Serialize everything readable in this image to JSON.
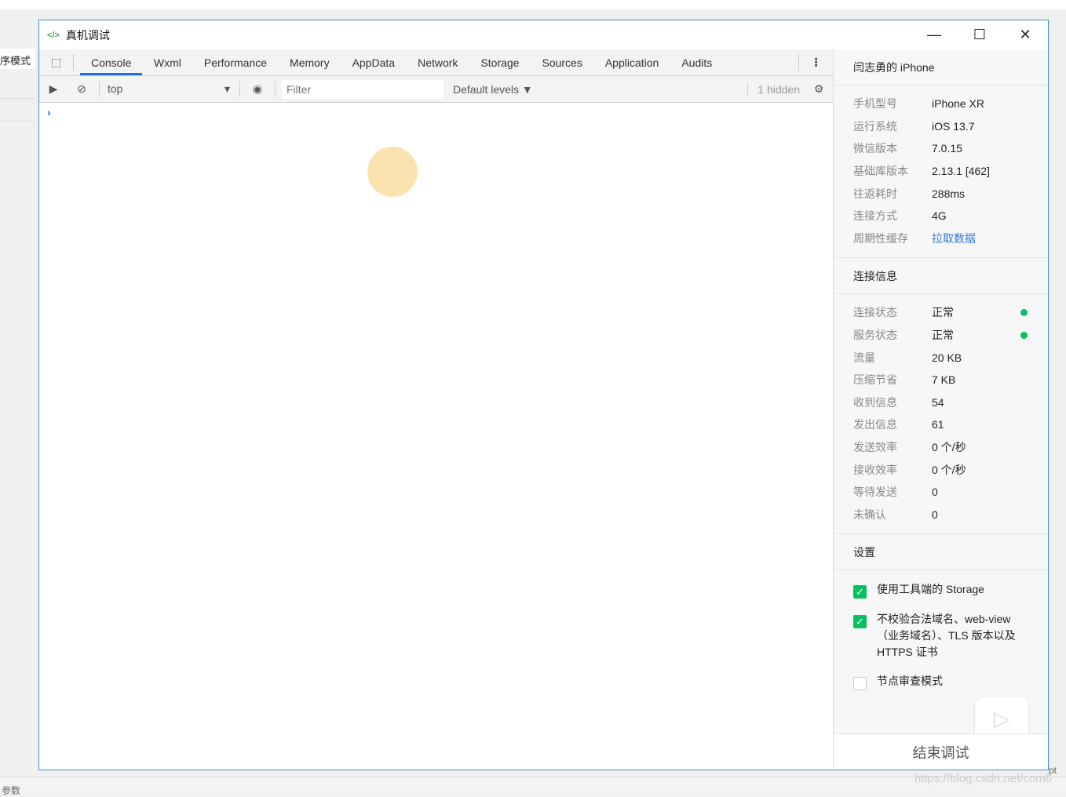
{
  "background": {
    "left_label": "序模式",
    "bottom_left": "参数",
    "bottom_right": "pt",
    "watermark": "https://blog.csdn.net/com6"
  },
  "window": {
    "title": "真机调试",
    "minimize": "—",
    "maximize": "☐",
    "close": "✕"
  },
  "tabs": [
    "Console",
    "Wxml",
    "Performance",
    "Memory",
    "AppData",
    "Network",
    "Storage",
    "Sources",
    "Application",
    "Audits"
  ],
  "toolbar": {
    "context": "top",
    "filter_placeholder": "Filter",
    "levels": "Default levels ▼",
    "hidden": "1 hidden"
  },
  "console": {
    "prompt": "›"
  },
  "device": {
    "title": "闫志勇的 iPhone",
    "rows": [
      {
        "k": "手机型号",
        "v": "iPhone XR"
      },
      {
        "k": "运行系统",
        "v": "iOS 13.7"
      },
      {
        "k": "微信版本",
        "v": "7.0.15"
      },
      {
        "k": "基础库版本",
        "v": "2.13.1 [462]"
      },
      {
        "k": "往返耗时",
        "v": "288ms"
      },
      {
        "k": "连接方式",
        "v": "4G"
      },
      {
        "k": "周期性缓存",
        "v": "拉取数据"
      }
    ]
  },
  "connection": {
    "title": "连接信息",
    "rows": [
      {
        "k": "连接状态",
        "v": "正常"
      },
      {
        "k": "服务状态",
        "v": "正常"
      },
      {
        "k": "流量",
        "v": "20 KB"
      },
      {
        "k": "压缩节省",
        "v": "7 KB"
      },
      {
        "k": "收到信息",
        "v": "54"
      },
      {
        "k": "发出信息",
        "v": "61"
      },
      {
        "k": "发送效率",
        "v": "0 个/秒"
      },
      {
        "k": "接收效率",
        "v": "0 个/秒"
      },
      {
        "k": "等待发送",
        "v": "0"
      },
      {
        "k": "未确认",
        "v": "0"
      }
    ]
  },
  "settings": {
    "title": "设置",
    "items": [
      {
        "label": "使用工具端的 Storage",
        "checked": true
      },
      {
        "label": "不校验合法域名、web-view（业务域名）、TLS 版本以及 HTTPS 证书",
        "checked": true
      },
      {
        "label": "节点审查模式",
        "checked": false
      }
    ]
  },
  "end_button": "结束调试",
  "colors": {
    "accent": "#1a73e8",
    "status_ok": "#07c160",
    "link": "#2f78d8"
  }
}
